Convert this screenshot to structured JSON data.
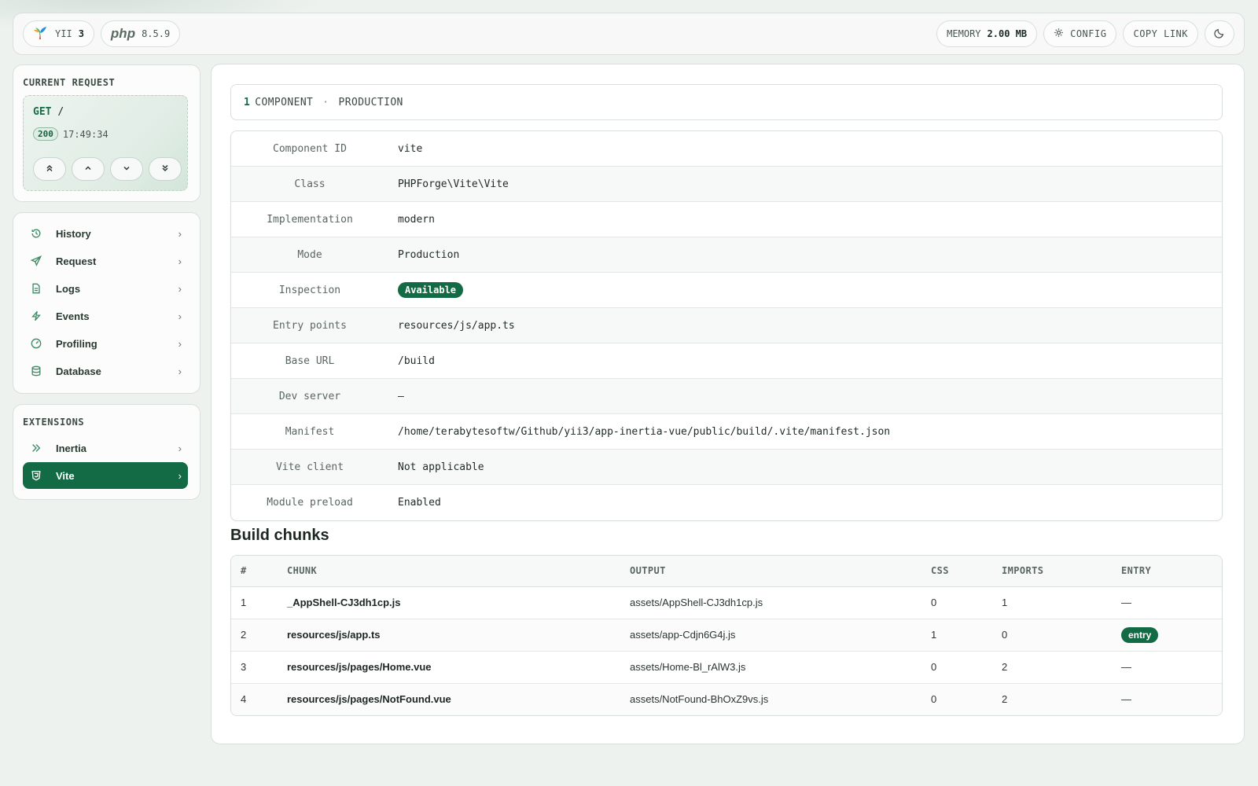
{
  "topbar": {
    "yii_label": "YII",
    "yii_version": "3",
    "php_label": "php",
    "php_version": "8.5.9",
    "memory_label": "MEMORY",
    "memory_value": "2.00 MB",
    "config_label": "CONFIG",
    "copy_link_label": "COPY LINK",
    "theme_icon": "moon-icon"
  },
  "current_request": {
    "title": "CURRENT REQUEST",
    "method": "GET",
    "path": "/",
    "status": "200",
    "time": "17:49:34"
  },
  "menu": [
    {
      "label": "History",
      "icon": "history-icon"
    },
    {
      "label": "Request",
      "icon": "send-icon"
    },
    {
      "label": "Logs",
      "icon": "file-icon"
    },
    {
      "label": "Events",
      "icon": "bolt-icon"
    },
    {
      "label": "Profiling",
      "icon": "gauge-icon"
    },
    {
      "label": "Database",
      "icon": "database-icon"
    }
  ],
  "extensions": {
    "title": "EXTENSIONS",
    "items": [
      {
        "label": "Inertia",
        "icon": "chevrons-icon",
        "active": false
      },
      {
        "label": "Vite",
        "icon": "shield-icon",
        "active": true
      }
    ]
  },
  "summary": {
    "count": "1",
    "count_label": "COMPONENT",
    "separator": "·",
    "mode": "PRODUCTION"
  },
  "properties": [
    {
      "key": "Component ID",
      "value": "vite"
    },
    {
      "key": "Class",
      "value": "PHPForge\\Vite\\Vite"
    },
    {
      "key": "Implementation",
      "value": "modern"
    },
    {
      "key": "Mode",
      "value": "Production"
    },
    {
      "key": "Inspection",
      "value": "Available",
      "badge": true
    },
    {
      "key": "Entry points",
      "value": "resources/js/app.ts"
    },
    {
      "key": "Base URL",
      "value": "/build"
    },
    {
      "key": "Dev server",
      "value": "—"
    },
    {
      "key": "Manifest",
      "value": "/home/terabytesoftw/Github/yii3/app-inertia-vue/public/build/.vite/manifest.json"
    },
    {
      "key": "Vite client",
      "value": "Not applicable"
    },
    {
      "key": "Module preload",
      "value": "Enabled"
    }
  ],
  "build_chunks": {
    "title": "Build chunks",
    "headers": [
      "#",
      "CHUNK",
      "OUTPUT",
      "CSS",
      "IMPORTS",
      "ENTRY"
    ],
    "rows": [
      {
        "num": "1",
        "chunk": "_AppShell-CJ3dh1cp.js",
        "output": "assets/AppShell-CJ3dh1cp.js",
        "css": "0",
        "imports": "1",
        "entry": "—",
        "is_entry": false
      },
      {
        "num": "2",
        "chunk": "resources/js/app.ts",
        "output": "assets/app-Cdjn6G4j.js",
        "css": "1",
        "imports": "0",
        "entry": "entry",
        "is_entry": true
      },
      {
        "num": "3",
        "chunk": "resources/js/pages/Home.vue",
        "output": "assets/Home-Bl_rAlW3.js",
        "css": "0",
        "imports": "2",
        "entry": "—",
        "is_entry": false
      },
      {
        "num": "4",
        "chunk": "resources/js/pages/NotFound.vue",
        "output": "assets/NotFound-BhOxZ9vs.js",
        "css": "0",
        "imports": "2",
        "entry": "—",
        "is_entry": false
      }
    ]
  },
  "colors": {
    "accent": "#136b45",
    "background": "#eef2ef"
  }
}
